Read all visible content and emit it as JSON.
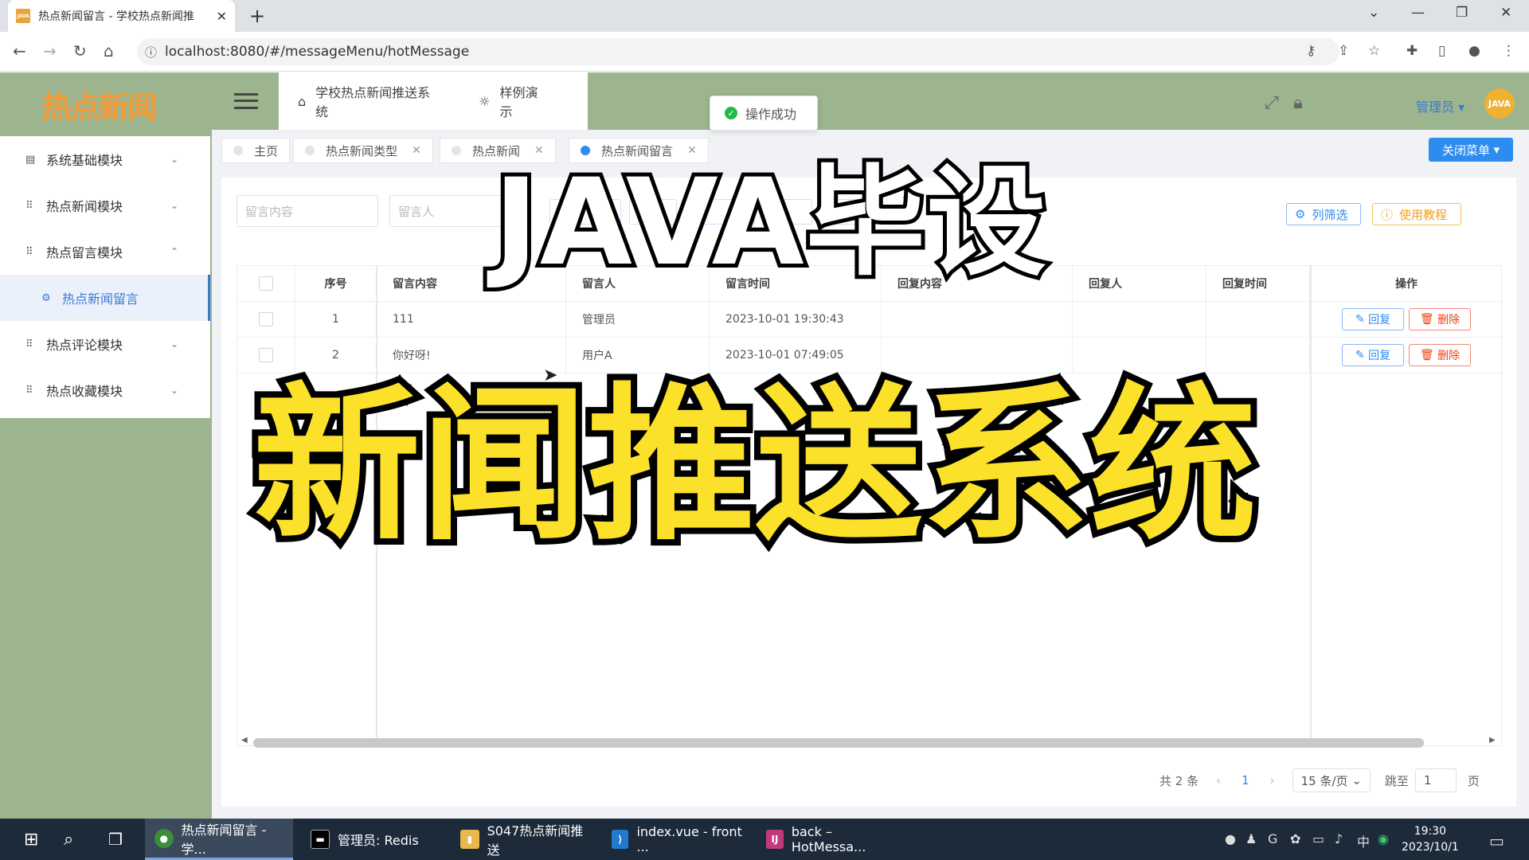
{
  "browser": {
    "tab_title": "热点新闻留言 - 学校热点新闻推",
    "favicon_text": "JAVA",
    "url": "localhost:8080/#/messageMenu/hotMessage"
  },
  "app": {
    "logo": "热点新闻",
    "topbar_links": [
      "学校热点新闻推送系统",
      "样例演示"
    ],
    "toast": "操作成功",
    "admin_label": "管理员",
    "avatar_text": "JAVA"
  },
  "sidebar": {
    "items": [
      {
        "label": "系统基础模块",
        "icon": "chart-icon",
        "chevron": "⌄"
      },
      {
        "label": "热点新闻模块",
        "icon": "grid-icon",
        "chevron": "⌄"
      },
      {
        "label": "热点留言模块",
        "icon": "grid-icon",
        "chevron": "⌃"
      },
      {
        "label": "热点新闻留言",
        "icon": "gear-icon",
        "chevron": ""
      },
      {
        "label": "热点评论模块",
        "icon": "grid-icon",
        "chevron": "⌄"
      },
      {
        "label": "热点收藏模块",
        "icon": "grid-icon",
        "chevron": "⌄"
      }
    ]
  },
  "page_tabs": [
    {
      "label": "主页",
      "closable": false,
      "active": false
    },
    {
      "label": "热点新闻类型",
      "closable": true,
      "active": false
    },
    {
      "label": "热点新闻",
      "closable": true,
      "active": false
    },
    {
      "label": "热点新闻留言",
      "closable": true,
      "active": true
    }
  ],
  "close_menu_label": "关闭菜单",
  "search": {
    "content_placeholder": "留言内容",
    "user_placeholder": "留言人"
  },
  "toolbar": {
    "column_filter": "列筛选",
    "tutorial": "使用教程"
  },
  "table": {
    "headers": [
      "序号",
      "留言内容",
      "留言人",
      "留言时间",
      "回复内容",
      "回复人",
      "回复时间",
      "操作"
    ],
    "rows": [
      {
        "no": "1",
        "content": "111",
        "user": "管理员",
        "time": "2023-10-01 19:30:43",
        "reply": "",
        "replier": "",
        "reply_time": ""
      },
      {
        "no": "2",
        "content": "你好呀!",
        "user": "用户A",
        "time": "2023-10-01 07:49:05",
        "reply": "",
        "replier": "",
        "reply_time": ""
      }
    ],
    "reply_btn": "回复",
    "delete_btn": "删除"
  },
  "pager": {
    "total": "共 2 条",
    "current_page": "1",
    "page_size": "15 条/页",
    "goto_label": "跳至",
    "goto_value": "1",
    "page_unit": "页"
  },
  "overlay": {
    "top_text": "JAVA毕设",
    "main_text": "新闻推送系统"
  },
  "taskbar": {
    "items": [
      "热点新闻留言 - 学...",
      "管理员: Redis",
      "S047热点新闻推送",
      "index.vue - front ...",
      "back – HotMessa..."
    ],
    "time": "19:30",
    "date": "2023/10/1",
    "ime": "中"
  },
  "colors": {
    "sidebar_green": "#9cb58e",
    "accent_blue": "#2d8cf0",
    "overlay_yellow": "#fce12a",
    "logo_orange": "#f29b38"
  }
}
